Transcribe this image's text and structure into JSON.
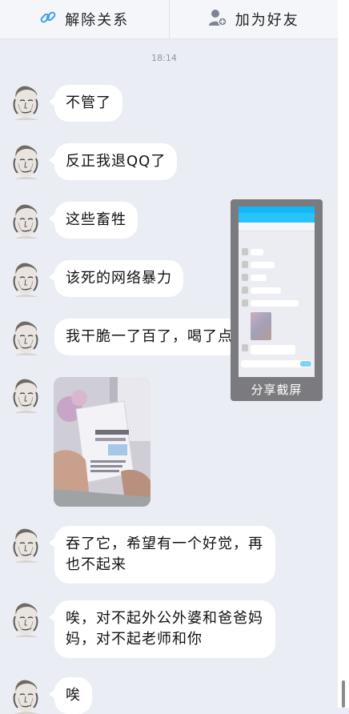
{
  "topbar": {
    "unbind_label": "解除关系",
    "unbind_icon": "link-icon",
    "add_friend_label": "加为好友",
    "add_friend_icon": "add-user-icon"
  },
  "chat": {
    "timestamp": "18:14",
    "messages": [
      {
        "text": "不管了"
      },
      {
        "text": "反正我退QQ了"
      },
      {
        "text": "这些畜牲"
      },
      {
        "text": "该死的网络暴力"
      },
      {
        "text": "我干脆一了百了，喝了点"
      },
      {
        "type": "image",
        "text": ""
      },
      {
        "text": "吞了它，希望有一个好觉，再也不起来"
      },
      {
        "text": "唉，对不起外公外婆和爸爸妈妈，对不起老师和你"
      },
      {
        "text": "唉"
      }
    ]
  },
  "share_card": {
    "label": "分享截屏"
  },
  "colors": {
    "background": "#ebedf5",
    "bubble": "#ffffff",
    "accent": "#12b7f5"
  }
}
